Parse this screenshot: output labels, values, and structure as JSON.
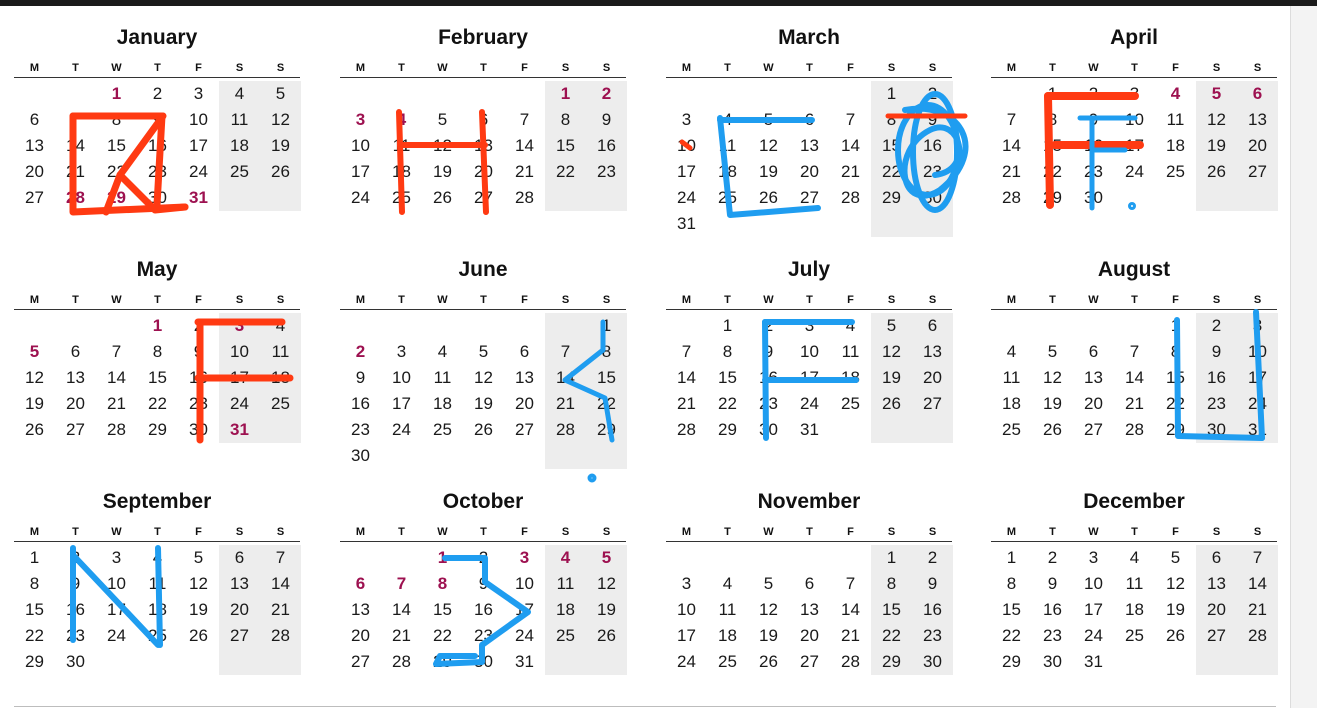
{
  "weekday_letters": [
    "M",
    "T",
    "W",
    "T",
    "F",
    "S",
    "S"
  ],
  "colors": {
    "holiday": "#9d1150",
    "weekend_shade": "#ededed",
    "red_ink": "#ff3a12",
    "blue_ink": "#1f9df0"
  },
  "months": [
    {
      "name": "January",
      "offset": 2,
      "days": 31,
      "holidays": [
        1,
        28,
        29,
        31
      ]
    },
    {
      "name": "February",
      "offset": 5,
      "days": 28,
      "holidays": [
        1,
        2,
        3,
        4
      ]
    },
    {
      "name": "March",
      "offset": 5,
      "days": 31,
      "holidays": []
    },
    {
      "name": "April",
      "offset": 1,
      "days": 30,
      "holidays": [
        4,
        5,
        6
      ]
    },
    {
      "name": "May",
      "offset": 3,
      "days": 31,
      "holidays": [
        1,
        3,
        5,
        31
      ]
    },
    {
      "name": "June",
      "offset": 6,
      "days": 30,
      "holidays": [
        2
      ]
    },
    {
      "name": "July",
      "offset": 1,
      "days": 31,
      "holidays": []
    },
    {
      "name": "August",
      "offset": 4,
      "days": 31,
      "holidays": []
    },
    {
      "name": "September",
      "offset": 0,
      "days": 30,
      "holidays": []
    },
    {
      "name": "October",
      "offset": 2,
      "days": 31,
      "holidays": [
        1,
        3,
        4,
        5,
        6,
        7,
        8
      ]
    },
    {
      "name": "November",
      "offset": 5,
      "days": 30,
      "holidays": []
    },
    {
      "name": "December",
      "offset": 0,
      "days": 31,
      "holidays": []
    }
  ]
}
